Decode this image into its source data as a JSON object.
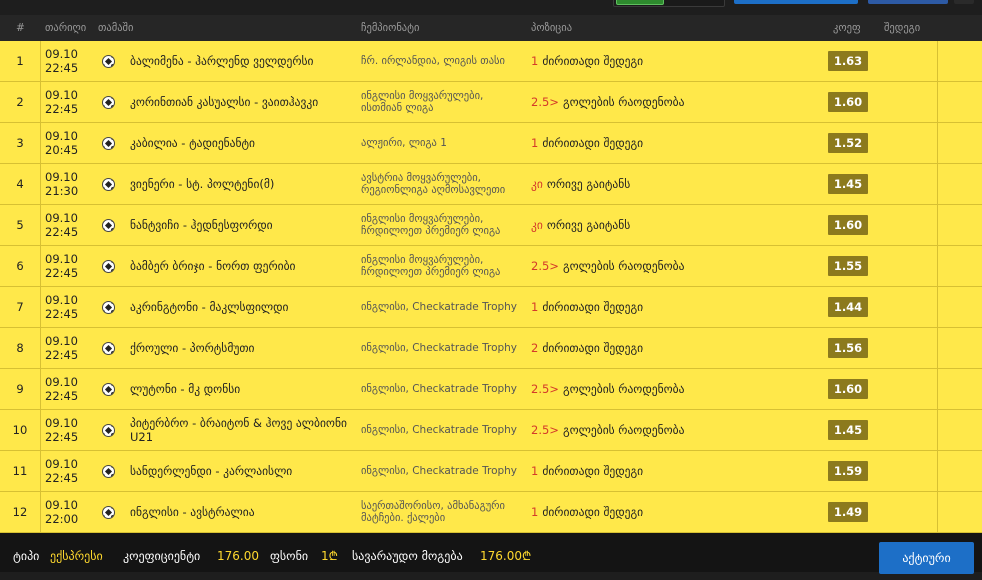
{
  "header": {
    "num": "#",
    "date": "თარიღი",
    "match": "თამაში",
    "championship": "ჩემპიონატი",
    "position": "პოზიცია",
    "odds": "კოეფ",
    "result": "შედეგი"
  },
  "rows": [
    {
      "num": "1",
      "date": "09.10",
      "time": "22:45",
      "match": "ბალიმენა - ჰარლენდ ველდერსი",
      "championship": "ჩრ. ირლანდია, ლიგის თასი",
      "selection": "1",
      "market": "ძირითადი შედეგი",
      "odds": "1.63"
    },
    {
      "num": "2",
      "date": "09.10",
      "time": "22:45",
      "match": "კორინთიან კასუალსი - ვაითჰავკი",
      "championship": "ინგლისი მოყვარულები, ისთმიან ლიგა",
      "selection": "2.5>",
      "market": "გოლების რაოდენობა",
      "odds": "1.60"
    },
    {
      "num": "3",
      "date": "09.10",
      "time": "20:45",
      "match": "კაბილია - ტადიენანტი",
      "championship": "ალჟირი, ლიგა 1",
      "selection": "1",
      "market": "ძირითადი შედეგი",
      "odds": "1.52"
    },
    {
      "num": "4",
      "date": "09.10",
      "time": "21:30",
      "match": "ვიენერი - სტ. პოლტენი(მ)",
      "championship": "ავსტრია მოყვარულები, რეგიონლიგა აღმოსავლეთი",
      "selection": "კი",
      "market": "ორივე გაიტანს",
      "odds": "1.45"
    },
    {
      "num": "5",
      "date": "09.10",
      "time": "22:45",
      "match": "ნანტვიჩი - ჰედნესფორდი",
      "championship": "ინგლისი მოყვარულები, ჩრდილოეთ პრემიერ ლიგა",
      "selection": "კი",
      "market": "ორივე გაიტანს",
      "odds": "1.60"
    },
    {
      "num": "6",
      "date": "09.10",
      "time": "22:45",
      "match": "ბამბერ ბრიჯი - ნორთ ფერიბი",
      "championship": "ინგლისი მოყვარულები, ჩრდილოეთ პრემიერ ლიგა",
      "selection": "2.5>",
      "market": "გოლების რაოდენობა",
      "odds": "1.55"
    },
    {
      "num": "7",
      "date": "09.10",
      "time": "22:45",
      "match": "აკრინგტონი - მაკლსფილდი",
      "championship": "ინგლისი, Checkatrade Trophy",
      "selection": "1",
      "market": "ძირითადი შედეგი",
      "odds": "1.44"
    },
    {
      "num": "8",
      "date": "09.10",
      "time": "22:45",
      "match": "ქროული - პორტსმუთი",
      "championship": "ინგლისი, Checkatrade Trophy",
      "selection": "2",
      "market": "ძირითადი შედეგი",
      "odds": "1.56"
    },
    {
      "num": "9",
      "date": "09.10",
      "time": "22:45",
      "match": "ლუტონი - მკ დონსი",
      "championship": "ინგლისი, Checkatrade Trophy",
      "selection": "2.5>",
      "market": "გოლების რაოდენობა",
      "odds": "1.60"
    },
    {
      "num": "10",
      "date": "09.10",
      "time": "22:45",
      "match": "პიტერბრო - ბრაიტონ & ჰოვე ალბიონი U21",
      "championship": "ინგლისი, Checkatrade Trophy",
      "selection": "2.5>",
      "market": "გოლების რაოდენობა",
      "odds": "1.45"
    },
    {
      "num": "11",
      "date": "09.10",
      "time": "22:45",
      "match": "სანდერლენდი - კარლაისლი",
      "championship": "ინგლისი, Checkatrade Trophy",
      "selection": "1",
      "market": "ძირითადი შედეგი",
      "odds": "1.59"
    },
    {
      "num": "12",
      "date": "09.10",
      "time": "22:00",
      "match": "ინგლისი - ავსტრალია",
      "championship": "საერთაშორისო, ამხანაგური მატჩები. ქალები",
      "selection": "1",
      "market": "ძირითადი შედეგი",
      "odds": "1.49"
    }
  ],
  "footer": {
    "type_label": "ტიპი",
    "type_value": "ექსპრესი",
    "coef_label": "კოეფიციენტი",
    "coef_value": "176.00",
    "stake_label": "ფსონი",
    "stake_value": "1₾",
    "win_label": "სავარაუდო მოგება",
    "win_value": "176.00₾",
    "active_button": "აქტიური"
  },
  "colors": {
    "row_bg": "#ffe84a",
    "odds_bg": "#8c7a1d",
    "accent_blue": "#1d6fc7",
    "selection_red": "#d43a2a",
    "footer_yellow": "#ffd92e"
  },
  "icons": {
    "sport": "soccer-ball-icon"
  }
}
